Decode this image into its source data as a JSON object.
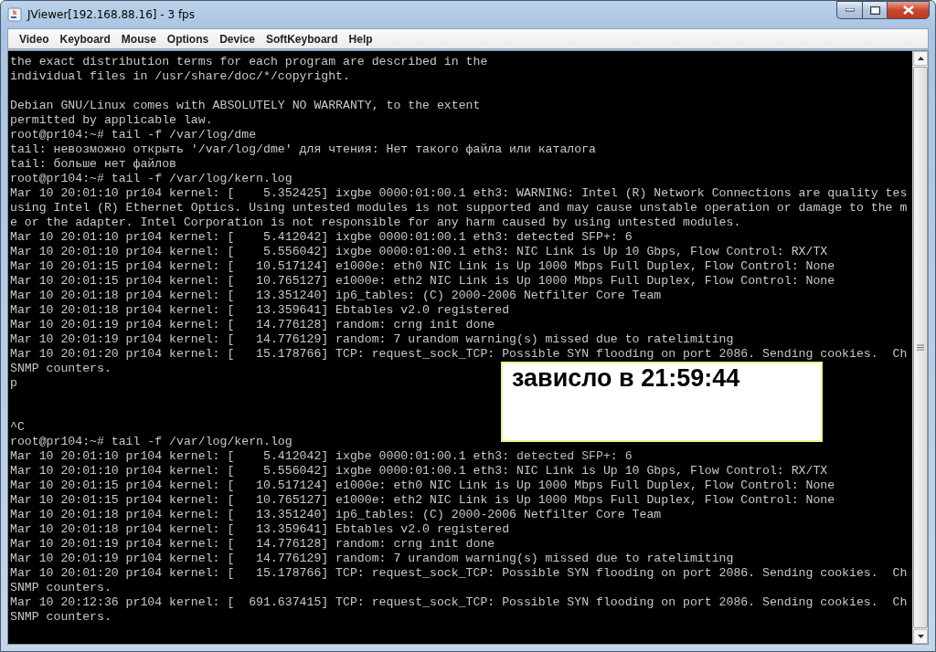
{
  "window": {
    "title": "JViewer[192.168.88.16] - 3 fps"
  },
  "menu": [
    "Video",
    "Keyboard",
    "Mouse",
    "Options",
    "Device",
    "SoftKeyboard",
    "Help"
  ],
  "terminal": {
    "lines": [
      {
        "kind": "text",
        "text": "the exact distribution terms for each program are described in the"
      },
      {
        "kind": "text",
        "text": "individual files in /usr/share/doc/*/copyright."
      },
      {
        "kind": "blank"
      },
      {
        "kind": "text",
        "text": "Debian GNU/Linux comes with ABSOLUTELY NO WARRANTY, to the extent"
      },
      {
        "kind": "text",
        "text": "permitted by applicable law."
      },
      {
        "kind": "text",
        "text": "root@pr104:~# tail -f /var/log/dme"
      },
      {
        "kind": "text",
        "text": "tail: невозможно открыть '/var/log/dme' для чтения: Нет такого файла или каталога"
      },
      {
        "kind": "text",
        "text": "tail: больше нет файлов"
      },
      {
        "kind": "text",
        "text": "root@pr104:~# tail -f /var/log/kern.log"
      },
      {
        "kind": "text",
        "text": "Mar 10 20:01:10 pr104 kernel: [    5.352425] ixgbe 0000:01:00.1 eth3: WARNING: Intel (R) Network Connections are quality tes"
      },
      {
        "kind": "text",
        "text": "using Intel (R) Ethernet Optics. Using untested modules is not supported and may cause unstable operation or damage to the m"
      },
      {
        "kind": "text",
        "text": "e or the adapter. Intel Corporation is not responsible for any harm caused by using untested modules."
      },
      {
        "kind": "text",
        "text": "Mar 10 20:01:10 pr104 kernel: [    5.412042] ixgbe 0000:01:00.1 eth3: detected SFP+: 6"
      },
      {
        "kind": "text",
        "text": "Mar 10 20:01:10 pr104 kernel: [    5.556042] ixgbe 0000:01:00.1 eth3: NIC Link is Up 10 Gbps, Flow Control: RX/TX"
      },
      {
        "kind": "text",
        "text": "Mar 10 20:01:15 pr104 kernel: [   10.517124] e1000e: eth0 NIC Link is Up 1000 Mbps Full Duplex, Flow Control: None"
      },
      {
        "kind": "text",
        "text": "Mar 10 20:01:15 pr104 kernel: [   10.765127] e1000e: eth2 NIC Link is Up 1000 Mbps Full Duplex, Flow Control: None"
      },
      {
        "kind": "text",
        "text": "Mar 10 20:01:18 pr104 kernel: [   13.351240] ip6_tables: (C) 2000-2006 Netfilter Core Team"
      },
      {
        "kind": "text",
        "text": "Mar 10 20:01:18 pr104 kernel: [   13.359641] Ebtables v2.0 registered"
      },
      {
        "kind": "text",
        "text": "Mar 10 20:01:19 pr104 kernel: [   14.776128] random: crng init done"
      },
      {
        "kind": "text",
        "text": "Mar 10 20:01:19 pr104 kernel: [   14.776129] random: 7 urandom warning(s) missed due to ratelimiting"
      },
      {
        "kind": "text",
        "text": "Mar 10 20:01:20 pr104 kernel: [   15.178766] TCP: request_sock_TCP: Possible SYN flooding on port 2086. Sending cookies.  Ch"
      },
      {
        "kind": "text",
        "text": "SNMP counters."
      },
      {
        "kind": "text",
        "text": "p"
      },
      {
        "kind": "blank"
      },
      {
        "kind": "blank"
      },
      {
        "kind": "text",
        "text": "^C"
      },
      {
        "kind": "text",
        "text": "root@pr104:~# tail -f /var/log/kern.log"
      },
      {
        "kind": "text",
        "text": "Mar 10 20:01:10 pr104 kernel: [    5.412042] ixgbe 0000:01:00.1 eth3: detected SFP+: 6"
      },
      {
        "kind": "text",
        "text": "Mar 10 20:01:10 pr104 kernel: [    5.556042] ixgbe 0000:01:00.1 eth3: NIC Link is Up 10 Gbps, Flow Control: RX/TX"
      },
      {
        "kind": "text",
        "text": "Mar 10 20:01:15 pr104 kernel: [   10.517124] e1000e: eth0 NIC Link is Up 1000 Mbps Full Duplex, Flow Control: None"
      },
      {
        "kind": "text",
        "text": "Mar 10 20:01:15 pr104 kernel: [   10.765127] e1000e: eth2 NIC Link is Up 1000 Mbps Full Duplex, Flow Control: None"
      },
      {
        "kind": "text",
        "text": "Mar 10 20:01:18 pr104 kernel: [   13.351240] ip6_tables: (C) 2000-2006 Netfilter Core Team"
      },
      {
        "kind": "text",
        "text": "Mar 10 20:01:18 pr104 kernel: [   13.359641] Ebtables v2.0 registered"
      },
      {
        "kind": "text",
        "text": "Mar 10 20:01:19 pr104 kernel: [   14.776128] random: crng init done"
      },
      {
        "kind": "text",
        "text": "Mar 10 20:01:19 pr104 kernel: [   14.776129] random: 7 urandom warning(s) missed due to ratelimiting"
      },
      {
        "kind": "text",
        "text": "Mar 10 20:01:20 pr104 kernel: [   15.178766] TCP: request_sock_TCP: Possible SYN flooding on port 2086. Sending cookies.  Ch"
      },
      {
        "kind": "text",
        "text": "SNMP counters."
      },
      {
        "kind": "text",
        "text": "Mar 10 20:12:36 pr104 kernel: [  691.637415] TCP: request_sock_TCP: Possible SYN flooding on port 2086. Sending cookies.  Ch"
      },
      {
        "kind": "text",
        "text": "SNMP counters."
      }
    ]
  },
  "note": {
    "text": "зависло в 21:59:44"
  }
}
